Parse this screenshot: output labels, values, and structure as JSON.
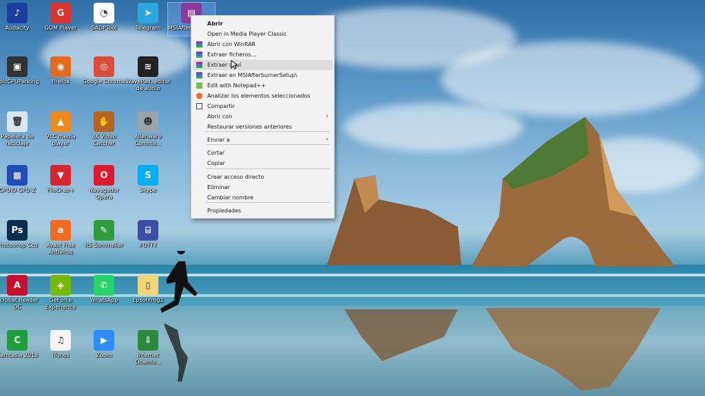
{
  "desktop_icons": [
    {
      "label": "Audacity",
      "color": "#1b3fa0",
      "glyph": "♪",
      "icon": "audacity-icon"
    },
    {
      "label": "GOM Player",
      "color": "#e0322c",
      "glyph": "G",
      "icon": "gom-player-icon"
    },
    {
      "label": "SADPTool",
      "color": "#ffffff",
      "glyph": "◔",
      "icon": "sadptool-icon"
    },
    {
      "label": "Telegram",
      "color": "#2ca5e0",
      "glyph": "➤",
      "icon": "telegram-icon"
    },
    {
      "label": "MSIAfterburnerSetup",
      "color": "#8b3a9e",
      "glyph": "▤",
      "icon": "winrar-archive-icon"
    },
    {
      "label": "ApicCPUParking",
      "color": "#333333",
      "glyph": "▣",
      "icon": "cpu-parking-icon"
    },
    {
      "label": "Firefox",
      "color": "#e76a1c",
      "glyph": "◉",
      "icon": "firefox-icon"
    },
    {
      "label": "Google Chrome",
      "color": "#dd4b39",
      "glyph": "◎",
      "icon": "chrome-icon"
    },
    {
      "label": "WavePad, editor de audio",
      "color": "#222222",
      "glyph": "≋",
      "icon": "wavepad-icon"
    },
    {
      "label": "Papelera de reciclaje",
      "color": "#d9e6ef",
      "glyph": "🗑",
      "icon": "recycle-bin-icon"
    },
    {
      "label": "VLC media player",
      "color": "#f08a1c",
      "glyph": "▲",
      "icon": "vlc-icon"
    },
    {
      "label": "4K Video Catcher",
      "color": "#b5651d",
      "glyph": "✋",
      "icon": "video-catcher-icon"
    },
    {
      "label": "Alienware Comma...",
      "color": "#9aa3ab",
      "glyph": "☻",
      "icon": "alienware-icon"
    },
    {
      "label": "GPUID GPU-Z",
      "color": "#1f4fb5",
      "glyph": "▦",
      "icon": "gpuz-icon"
    },
    {
      "label": "FileGrab+",
      "color": "#d9232d",
      "glyph": "▼",
      "icon": "filegrab-icon"
    },
    {
      "label": "Navegador Opera",
      "color": "#e0192b",
      "glyph": "O",
      "icon": "opera-icon"
    },
    {
      "label": "Skype",
      "color": "#00aff0",
      "glyph": "S",
      "icon": "skype-icon"
    },
    {
      "label": "Photoshop Ccd",
      "color": "#0b2e4f",
      "glyph": "Ps",
      "icon": "photoshop-icon"
    },
    {
      "label": "Avast Free Antivirus",
      "color": "#f26b21",
      "glyph": "a",
      "icon": "avast-icon"
    },
    {
      "label": "RS Sommelier",
      "color": "#2e9d3a",
      "glyph": "✎",
      "icon": "sommelier-icon"
    },
    {
      "label": "PUTTY",
      "color": "#3d4fa3",
      "glyph": "⌸",
      "icon": "putty-icon"
    },
    {
      "label": "Acrobat Reader DC",
      "color": "#c8102e",
      "glyph": "A",
      "icon": "acrobat-icon"
    },
    {
      "label": "GeForce Experience",
      "color": "#76b900",
      "glyph": "◈",
      "icon": "geforce-icon"
    },
    {
      "label": "WhatsApp",
      "color": "#25d366",
      "glyph": "✆",
      "icon": "whatsapp-icon"
    },
    {
      "label": "Epsonfrog2",
      "color": "#f3d57a",
      "glyph": "▯",
      "icon": "folder-icon"
    },
    {
      "label": "Camtasia 2018",
      "color": "#1e9e3c",
      "glyph": "C",
      "icon": "camtasia-icon"
    },
    {
      "label": "iTunes",
      "color": "#f5f5f5",
      "glyph": "♫",
      "icon": "itunes-icon"
    },
    {
      "label": "Zoom",
      "color": "#2d8cff",
      "glyph": "▶",
      "icon": "zoom-icon"
    },
    {
      "label": "Internet Downlo...",
      "color": "#2b8a3e",
      "glyph": "⇩",
      "icon": "idm-icon"
    }
  ],
  "context_menu": {
    "items": [
      {
        "label": "Abrir",
        "bold": true,
        "icon": ""
      },
      {
        "label": "Open in Media Player Classic",
        "icon": ""
      },
      {
        "label": "Abrir con WinRAR",
        "icon": "winrar"
      },
      {
        "label": "Extraer ficheros...",
        "icon": "winrar"
      },
      {
        "label": "Extraer aquí",
        "icon": "winrar",
        "hover": true
      },
      {
        "label": "Extraer en MSIAfterburnerSetup\\",
        "icon": "winrar"
      },
      {
        "label": "Edit with Notepad++",
        "icon": "notepad"
      },
      {
        "label": "Analizar los elementos seleccionados",
        "icon": "avast"
      },
      {
        "label": "Compartir",
        "icon": "share"
      },
      {
        "label": "Abrir con",
        "icon": "",
        "submenu": true
      },
      {
        "label": "Restaurar versiones anteriores",
        "icon": ""
      },
      {
        "label": "Enviar a",
        "icon": "",
        "submenu": true
      },
      {
        "label": "Cortar",
        "icon": ""
      },
      {
        "label": "Copiar",
        "icon": ""
      },
      {
        "label": "Crear acceso directo",
        "icon": ""
      },
      {
        "label": "Eliminar",
        "icon": ""
      },
      {
        "label": "Cambiar nombre",
        "icon": ""
      },
      {
        "label": "Propiedades",
        "icon": ""
      }
    ]
  }
}
